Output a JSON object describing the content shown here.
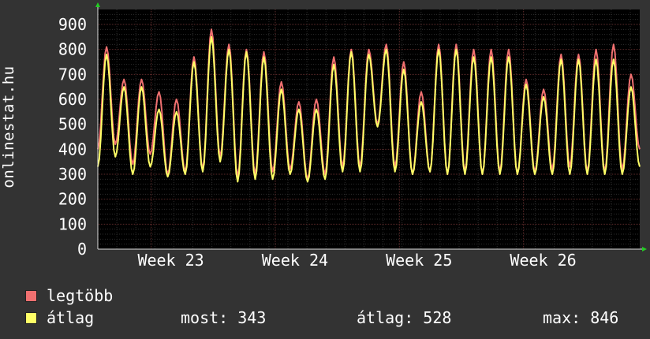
{
  "chart_data": {
    "type": "line",
    "ylabel": "onlinestat.hu",
    "yticks": [
      0,
      100,
      200,
      300,
      400,
      500,
      600,
      700,
      800,
      900
    ],
    "ylim": [
      0,
      960
    ],
    "xticks": [
      "Week 23",
      "Week 24",
      "Week 25",
      "Week 26"
    ],
    "grid": true,
    "series": [
      {
        "name": "legtöbb",
        "color": "#f07070",
        "values": [
          400,
          810,
          420,
          680,
          340,
          680,
          380,
          630,
          300,
          600,
          310,
          770,
          320,
          880,
          370,
          820,
          290,
          800,
          300,
          790,
          310,
          670,
          320,
          590,
          280,
          600,
          300,
          770,
          330,
          800,
          330,
          800,
          500,
          820,
          330,
          750,
          300,
          630,
          310,
          820,
          300,
          820,
          310,
          800,
          300,
          800,
          310,
          800,
          300,
          680,
          310,
          640,
          320,
          780,
          330,
          780,
          310,
          800,
          310,
          820,
          320,
          700,
          400
        ]
      },
      {
        "name": "átlag",
        "color": "#ffff66",
        "values": [
          330,
          780,
          370,
          650,
          300,
          650,
          330,
          560,
          290,
          550,
          300,
          750,
          310,
          850,
          350,
          800,
          270,
          790,
          280,
          770,
          280,
          640,
          300,
          560,
          270,
          560,
          280,
          740,
          310,
          790,
          310,
          780,
          490,
          800,
          310,
          720,
          300,
          590,
          310,
          800,
          300,
          800,
          300,
          770,
          300,
          770,
          300,
          770,
          300,
          660,
          300,
          610,
          300,
          760,
          300,
          760,
          300,
          760,
          300,
          760,
          300,
          650,
          330
        ]
      }
    ]
  },
  "legend": {
    "items": [
      {
        "label": "legtöbb",
        "color": "#f07070"
      },
      {
        "label": "átlag",
        "color": "#ffff66"
      }
    ]
  },
  "stats": {
    "current": "most: 343",
    "average": "átlag: 528",
    "max": "max: 846"
  }
}
